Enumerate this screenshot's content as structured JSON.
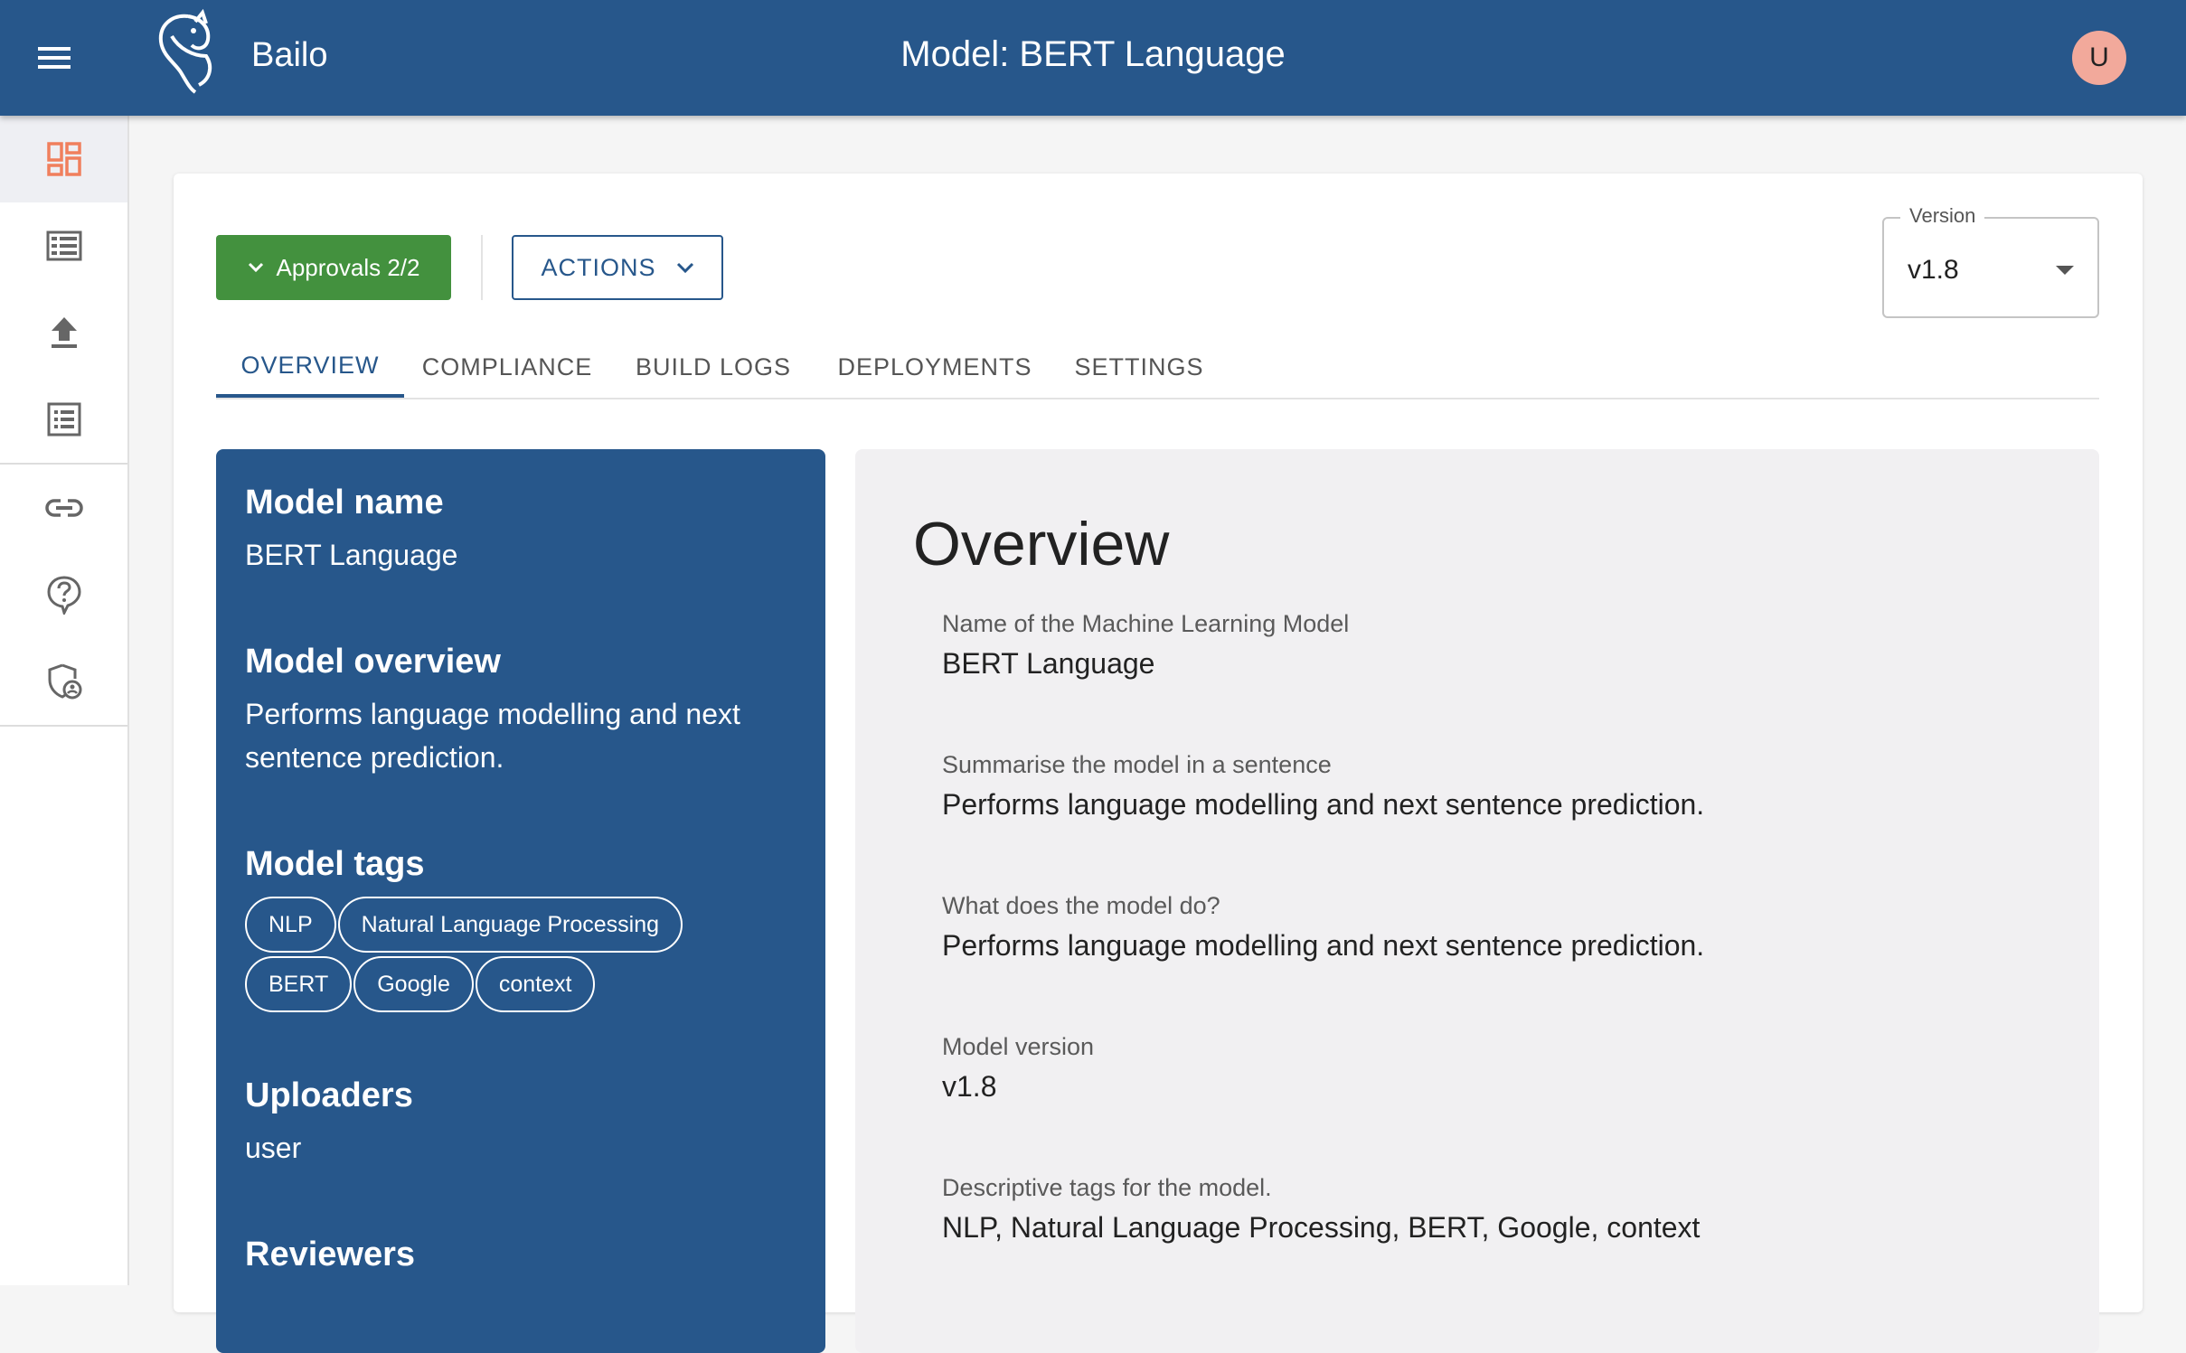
{
  "header": {
    "menu_icon": "hamburger-menu-icon",
    "logo_icon": "bailo-logo-icon",
    "app_name": "Bailo",
    "title": "Model: BERT Language",
    "avatar_initial": "U"
  },
  "sidebar": {
    "items": [
      {
        "icon": "dashboard-icon",
        "active": true
      },
      {
        "icon": "list-icon",
        "active": false
      },
      {
        "icon": "upload-icon",
        "active": false
      },
      {
        "icon": "checklist-icon",
        "active": false
      },
      {
        "icon": "link-icon",
        "active": false
      },
      {
        "icon": "help-icon",
        "active": false
      },
      {
        "icon": "shield-admin-icon",
        "active": false
      }
    ]
  },
  "toolbar": {
    "approvals_label": "Approvals 2/2",
    "actions_label": "ACTIONS",
    "version_label": "Version",
    "version_value": "v1.8"
  },
  "tabs": [
    {
      "label": "OVERVIEW",
      "active": true
    },
    {
      "label": "COMPLIANCE",
      "active": false
    },
    {
      "label": "BUILD LOGS",
      "active": false
    },
    {
      "label": "DEPLOYMENTS",
      "active": false
    },
    {
      "label": "SETTINGS",
      "active": false
    }
  ],
  "summary": {
    "model_name_heading": "Model name",
    "model_name": "BERT Language",
    "model_overview_heading": "Model overview",
    "model_overview": "Performs language modelling and next sentence prediction.",
    "model_tags_heading": "Model tags",
    "tags": [
      "NLP",
      "Natural Language Processing",
      "BERT",
      "Google",
      "context"
    ],
    "uploaders_heading": "Uploaders",
    "uploaders": "user",
    "reviewers_heading": "Reviewers"
  },
  "overview": {
    "title": "Overview",
    "fields": [
      {
        "label": "Name of the Machine Learning Model",
        "value": "BERT Language"
      },
      {
        "label": "Summarise the model in a sentence",
        "value": "Performs language modelling and next sentence prediction."
      },
      {
        "label": "What does the model do?",
        "value": "Performs language modelling and next sentence prediction."
      },
      {
        "label": "Model version",
        "value": "v1.8"
      },
      {
        "label": "Descriptive tags for the model.",
        "value": "NLP, Natural Language Processing, BERT, Google, context"
      }
    ]
  },
  "colors": {
    "primary": "#27578b",
    "approval_green": "#43913e",
    "active_icon": "#f07f5c",
    "avatar_bg": "#f2a99b"
  }
}
